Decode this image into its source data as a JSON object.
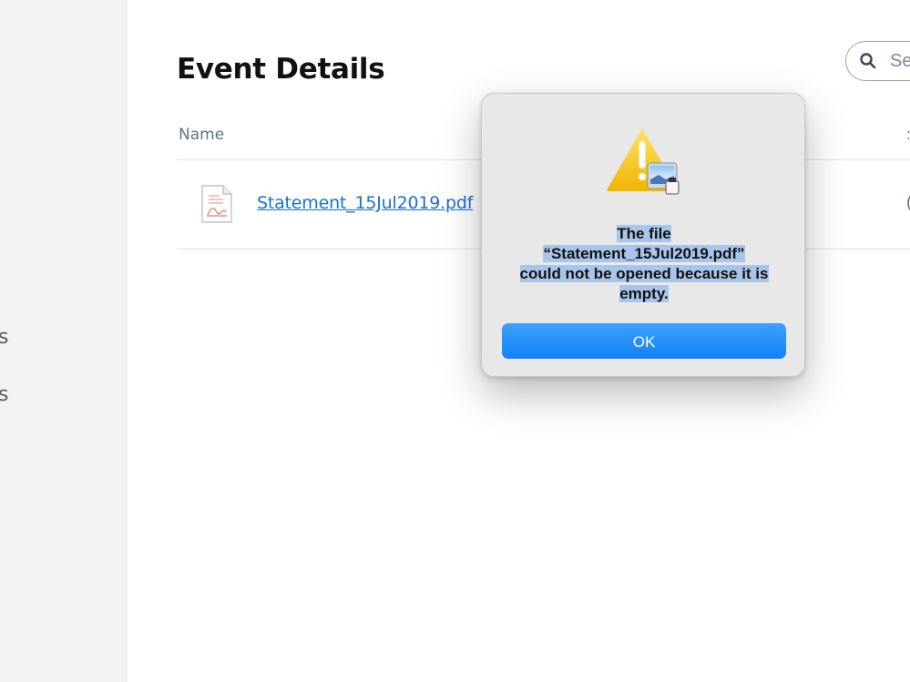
{
  "sidebar": {
    "items": [
      {
        "label": "s"
      },
      {
        "label": "s"
      }
    ]
  },
  "main": {
    "title": "Event Details",
    "search": {
      "placeholder": "Se"
    },
    "table": {
      "columns": [
        "Name"
      ],
      "rows": [
        {
          "file_name": "Statement_15Jul2019.pdf"
        }
      ]
    }
  },
  "dialog": {
    "message_line1": "The file",
    "message_line2": "“Statement_15Jul2019.pdf”",
    "message_line3": "could not be opened because it is",
    "message_line4": "empty.",
    "ok_label": "OK",
    "button_color": "#1281f7",
    "selection_color": "#a9c4ea"
  },
  "icons": [
    "search-icon",
    "pdf-file-icon",
    "warning-icon",
    "preview-app-icon"
  ]
}
